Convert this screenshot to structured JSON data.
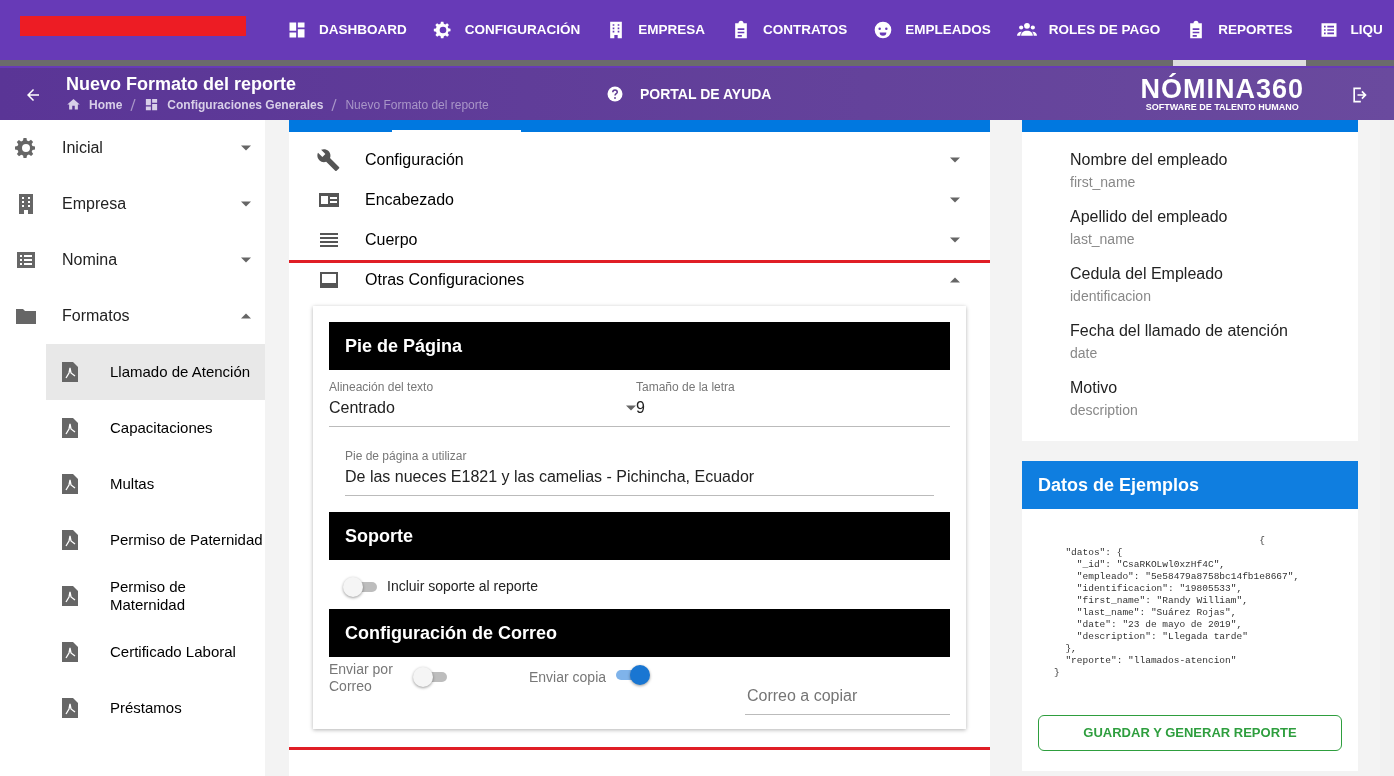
{
  "top_nav": {
    "items": [
      {
        "label": "DASHBOARD",
        "selected": false
      },
      {
        "label": "CONFIGURACIÓN",
        "selected": false
      },
      {
        "label": "EMPRESA",
        "selected": false
      },
      {
        "label": "CONTRATOS",
        "selected": false
      },
      {
        "label": "EMPLEADOS",
        "selected": false
      },
      {
        "label": "ROLES DE PAGO",
        "selected": false
      },
      {
        "label": "REPORTES",
        "selected": true
      },
      {
        "label": "LIQU",
        "selected": false
      }
    ]
  },
  "header": {
    "title": "Nuevo Formato del reporte",
    "breadcrumbs": [
      {
        "label": "Home"
      },
      {
        "label": "Configuraciones Generales"
      },
      {
        "label": "Nuevo Formato del reporte"
      }
    ],
    "help": "PORTAL DE AYUDA",
    "brand": "NÓMINA360",
    "brand_tagline": "SOFTWARE DE TALENTO HUMANO"
  },
  "sidebar": {
    "items": [
      {
        "label": "Inicial",
        "expanded": false
      },
      {
        "label": "Empresa",
        "expanded": false
      },
      {
        "label": "Nomina",
        "expanded": false
      },
      {
        "label": "Formatos",
        "expanded": true,
        "children": [
          {
            "label": "Llamado de Atención",
            "selected": true
          },
          {
            "label": "Capacitaciones",
            "selected": false
          },
          {
            "label": "Multas",
            "selected": false
          },
          {
            "label": "Permiso de Paternidad",
            "selected": false
          },
          {
            "label": "Permiso de Maternidad",
            "selected": false
          },
          {
            "label": "Certificado Laboral",
            "selected": false
          },
          {
            "label": "Préstamos",
            "selected": false
          }
        ]
      }
    ]
  },
  "sections": [
    {
      "label": "Configuración",
      "expanded": false
    },
    {
      "label": "Encabezado",
      "expanded": false
    },
    {
      "label": "Cuerpo",
      "expanded": false
    },
    {
      "label": "Otras Configuraciones",
      "expanded": true
    }
  ],
  "other_settings": {
    "footer_title": "Pie de Página",
    "alignment": {
      "label": "Alineación del texto",
      "value": "Centrado"
    },
    "font_size": {
      "label": "Tamaño de la letra",
      "value": "9"
    },
    "footer_text": {
      "label": "Pie de página a utilizar",
      "value": "De las nueces E1821 y las camelias - Pichincha, Ecuador"
    },
    "support_title": "Soporte",
    "support_toggle": {
      "label": "Incluir soporte al reporte",
      "on": false
    },
    "mail_title": "Configuración de Correo",
    "send_mail": {
      "label": "Enviar por Correo",
      "on": false
    },
    "send_copy": {
      "label": "Enviar copia",
      "on": true
    },
    "copy_email": {
      "placeholder": "Correo a copiar"
    }
  },
  "variables": [
    {
      "label": "Nombre del empleado",
      "key": "first_name"
    },
    {
      "label": "Apellido del empleado",
      "key": "last_name"
    },
    {
      "label": "Cedula del Empleado",
      "key": "identificacion"
    },
    {
      "label": "Fecha del llamado de atención",
      "key": "date"
    },
    {
      "label": "Motivo",
      "key": "description"
    }
  ],
  "examples": {
    "title": "Datos de Ejemplos",
    "code": "                                    {\n  \"datos\": {\n    \"_id\": \"CsaRKOLwl0xzHf4C\",\n    \"empleado\": \"5e58479a8758bc14fb1e8667\",\n    \"identificacion\": \"19805533\",\n    \"first_name\": \"Randy William\",\n    \"last_name\": \"Suárez Rojas\",\n    \"date\": \"23 de mayo de 2019\",\n    \"description\": \"Llegada tarde\"\n  },\n  \"reporte\": \"llamados-atencion\"\n}",
    "button": "GUARDAR Y GENERAR REPORTE"
  }
}
